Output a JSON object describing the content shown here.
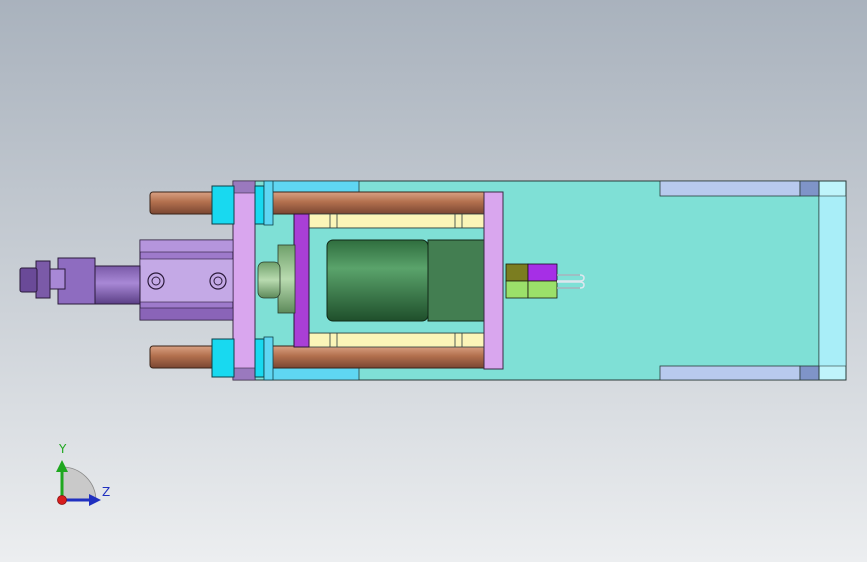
{
  "view": {
    "background_top": "#a9b2bd",
    "background_bottom": "#eceef0"
  },
  "triad": {
    "y_label": "Y",
    "z_label": "Z",
    "y_color": "#1fa71f",
    "z_color": "#2030c0",
    "origin_color": "#d81e1e"
  },
  "model": {
    "base_plate_color": "#7fe0d6",
    "rod_color": "#b3704e",
    "end_plate_color": "#d9a6ee",
    "collar_color": "#18d9f0",
    "cylinder_color": "#9e7acb",
    "motor_color": "#3f8a55",
    "spacer_color": "#fbf5b8",
    "slot_color": "#b8caee"
  }
}
